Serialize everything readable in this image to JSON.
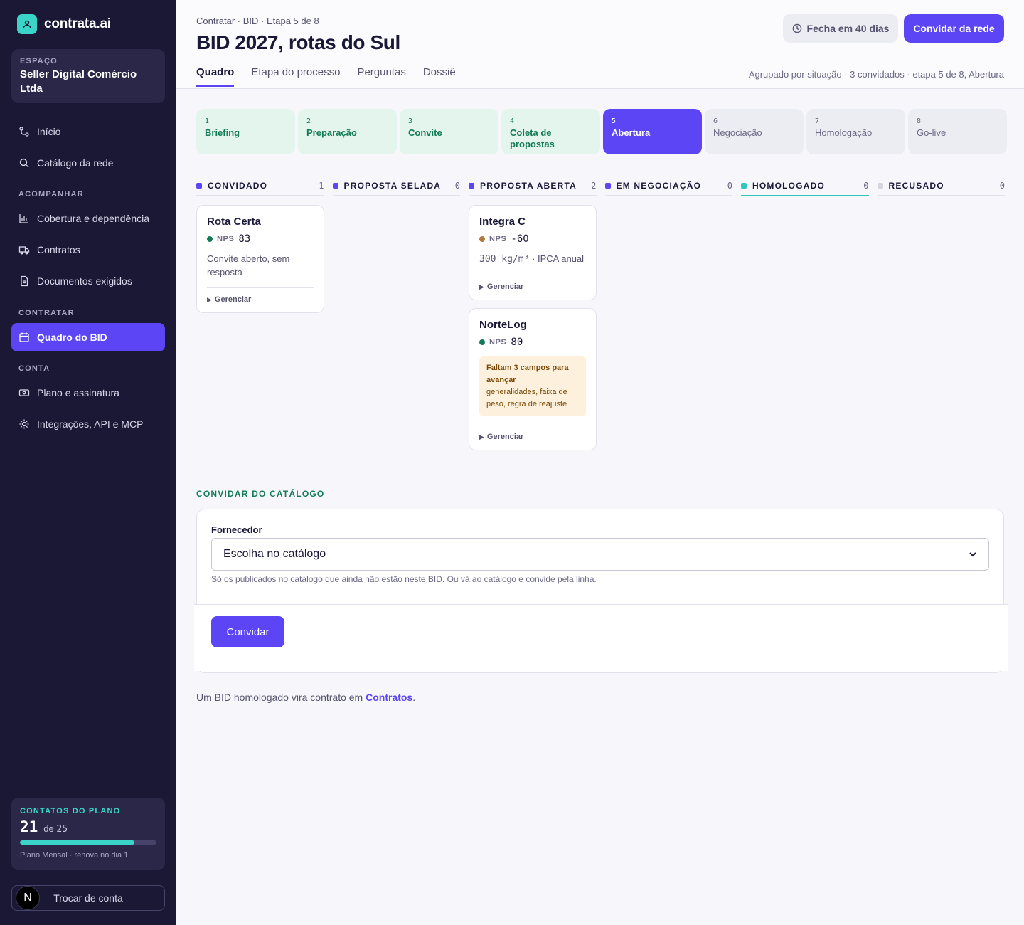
{
  "brand": {
    "name": "contrata.ai"
  },
  "space": {
    "label": "ESPAÇO",
    "name": "Seller Digital Comércio Ltda"
  },
  "nav": {
    "top": [
      {
        "label": "Início",
        "icon": "nodes-icon"
      },
      {
        "label": "Catálogo da rede",
        "icon": "search-icon"
      }
    ],
    "section_follow": "ACOMPANHAR",
    "follow": [
      {
        "label": "Cobertura e dependência",
        "icon": "bar-chart-icon"
      },
      {
        "label": "Contratos",
        "icon": "truck-icon"
      },
      {
        "label": "Documentos exigidos",
        "icon": "document-icon"
      }
    ],
    "section_hire": "CONTRATAR",
    "hire": [
      {
        "label": "Quadro do BID",
        "icon": "calendar-icon",
        "active": true
      }
    ],
    "section_account": "CONTA",
    "account": [
      {
        "label": "Plano e assinatura",
        "icon": "money-icon"
      },
      {
        "label": "Integrações, API e MCP",
        "icon": "sun-icon"
      }
    ]
  },
  "plan": {
    "label": "CONTATOS DO PLANO",
    "used": "21",
    "of_text": "de",
    "total": "25",
    "progress": 0.84,
    "note": "Plano Mensal · renova no dia 1"
  },
  "account_switch": {
    "avatar": "N",
    "label": "Trocar de conta"
  },
  "header": {
    "breadcrumb": "Contratar · BID · Etapa 5 de 8",
    "title": "BID 2027, rotas do Sul",
    "deadline": "Fecha em 40 dias",
    "invite_network": "Convidar da rede",
    "meta": "Agrupado por situação · 3 convidados · etapa 5 de 8, Abertura",
    "tabs": [
      {
        "label": "Quadro",
        "active": true
      },
      {
        "label": "Etapa do processo",
        "active": false
      },
      {
        "label": "Perguntas",
        "active": false
      },
      {
        "label": "Dossiê",
        "active": false
      }
    ]
  },
  "steps": [
    {
      "num": "1",
      "label": "Briefing",
      "state": "done"
    },
    {
      "num": "2",
      "label": "Preparação",
      "state": "done"
    },
    {
      "num": "3",
      "label": "Convite",
      "state": "done"
    },
    {
      "num": "4",
      "label": "Coleta de propostas",
      "state": "done"
    },
    {
      "num": "5",
      "label": "Abertura",
      "state": "current"
    },
    {
      "num": "6",
      "label": "Negociação",
      "state": "todo"
    },
    {
      "num": "7",
      "label": "Homologação",
      "state": "todo"
    },
    {
      "num": "8",
      "label": "Go-live",
      "state": "todo"
    }
  ],
  "columns": [
    {
      "title": "CONVIDADO",
      "count": "1",
      "color": "#5b45f5",
      "cards": [
        {
          "name": "Rota Certa",
          "nps_label": "NPS",
          "nps": "83",
          "dot": "#137a57",
          "note": "Convite aberto, sem resposta",
          "manage": "Gerenciar"
        }
      ]
    },
    {
      "title": "PROPOSTA SELADA",
      "count": "0",
      "color": "#5b45f5",
      "cards": []
    },
    {
      "title": "PROPOSTA ABERTA",
      "count": "2",
      "color": "#5b45f5",
      "cards": [
        {
          "name": "Integra C",
          "nps_label": "NPS",
          "nps": "-60",
          "dot": "#b07a3c",
          "spec": "300 kg/m³",
          "spec_suffix": " · IPCA anual",
          "manage": "Gerenciar"
        },
        {
          "name": "NorteLog",
          "nps_label": "NPS",
          "nps": "80",
          "dot": "#137a57",
          "warn_title": "Faltam 3 campos para avançar",
          "warn_body": "generalidades, faixa de peso, regra de reajuste",
          "manage": "Gerenciar"
        }
      ]
    },
    {
      "title": "EM NEGOCIAÇÃO",
      "count": "0",
      "color": "#5b45f5",
      "cards": []
    },
    {
      "title": "HOMOLOGADO",
      "count": "0",
      "color": "#2fc8c0",
      "cards": []
    },
    {
      "title": "RECUSADO",
      "count": "0",
      "color": "#d6d5e0",
      "cards": []
    }
  ],
  "invite": {
    "section_title": "CONVIDAR DO CATÁLOGO",
    "field_label": "Fornecedor",
    "select_value": "Escolha no catálogo",
    "help": "Só os publicados no catálogo que ainda não estão neste BID. Ou vá ao catálogo e convide pela linha.",
    "button": "Convidar"
  },
  "footnote": {
    "text": "Um BID homologado vira contrato em ",
    "link": "Contratos",
    "suffix": "."
  }
}
